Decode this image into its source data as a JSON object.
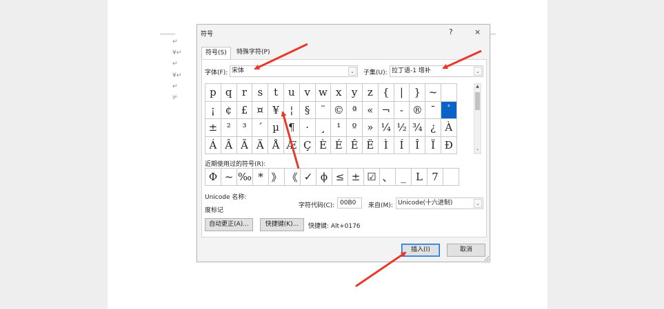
{
  "doc": {
    "marks": [
      "↵",
      "¥↵",
      "↵",
      "¥↵",
      "↵",
      "⊬"
    ]
  },
  "dialog": {
    "title": "符号",
    "help": "?",
    "close": "×",
    "tabs": [
      {
        "label": "符号(S)",
        "active": true
      },
      {
        "label": "特殊字符(P)",
        "active": false
      }
    ],
    "font_label": "字体(F):",
    "font_value": "宋体",
    "subset_label": "子集(U):",
    "subset_value": "拉丁语-1 增补",
    "grid": [
      [
        "p",
        "q",
        "r",
        "s",
        "t",
        "u",
        "v",
        "w",
        "x",
        "y",
        "z",
        "{",
        "|",
        "}",
        "~"
      ],
      [
        "¡",
        "¢",
        "£",
        "¤",
        "¥",
        "¦",
        "§",
        "¨",
        "©",
        "ª",
        "«",
        "¬",
        "-",
        "®",
        "¯",
        "°"
      ],
      [
        "±",
        "²",
        "³",
        "´",
        "µ",
        "¶",
        "·",
        "¸",
        "¹",
        "º",
        "»",
        "¼",
        "½",
        "¾",
        "¿",
        "À"
      ],
      [
        "Á",
        "Â",
        "Ã",
        "Ä",
        "Å",
        "Æ",
        "Ç",
        "È",
        "É",
        "Ê",
        "Ë",
        "Ì",
        "Í",
        "Î",
        "Ï",
        "Ð"
      ]
    ],
    "selected_symbol": "°",
    "recent_label": "近期使用过的符号(R):",
    "recent": [
      "Φ",
      "~",
      "‰",
      "*",
      "》",
      "《",
      "✓",
      "ϕ",
      "≤",
      "±",
      "☑",
      "、",
      "_",
      "L",
      "7",
      ""
    ],
    "unicode_name_label": "Unicode 名称:",
    "unicode_name": "度标记",
    "charcode_label": "字符代码(C):",
    "charcode_value": "00B0",
    "from_label": "来自(M):",
    "from_value": "Unicode(十六进制)",
    "autocorrect_button": "自动更正(A)...",
    "shortcut_button": "快捷键(K)...",
    "shortcut_text": "快捷键: Alt+0176",
    "insert_button": "插入(I)",
    "cancel_button": "取消"
  },
  "colors": {
    "annotation_arrow": "#e8392b",
    "selected_cell": "#0b63c8",
    "primary_border": "#1a73d1"
  }
}
